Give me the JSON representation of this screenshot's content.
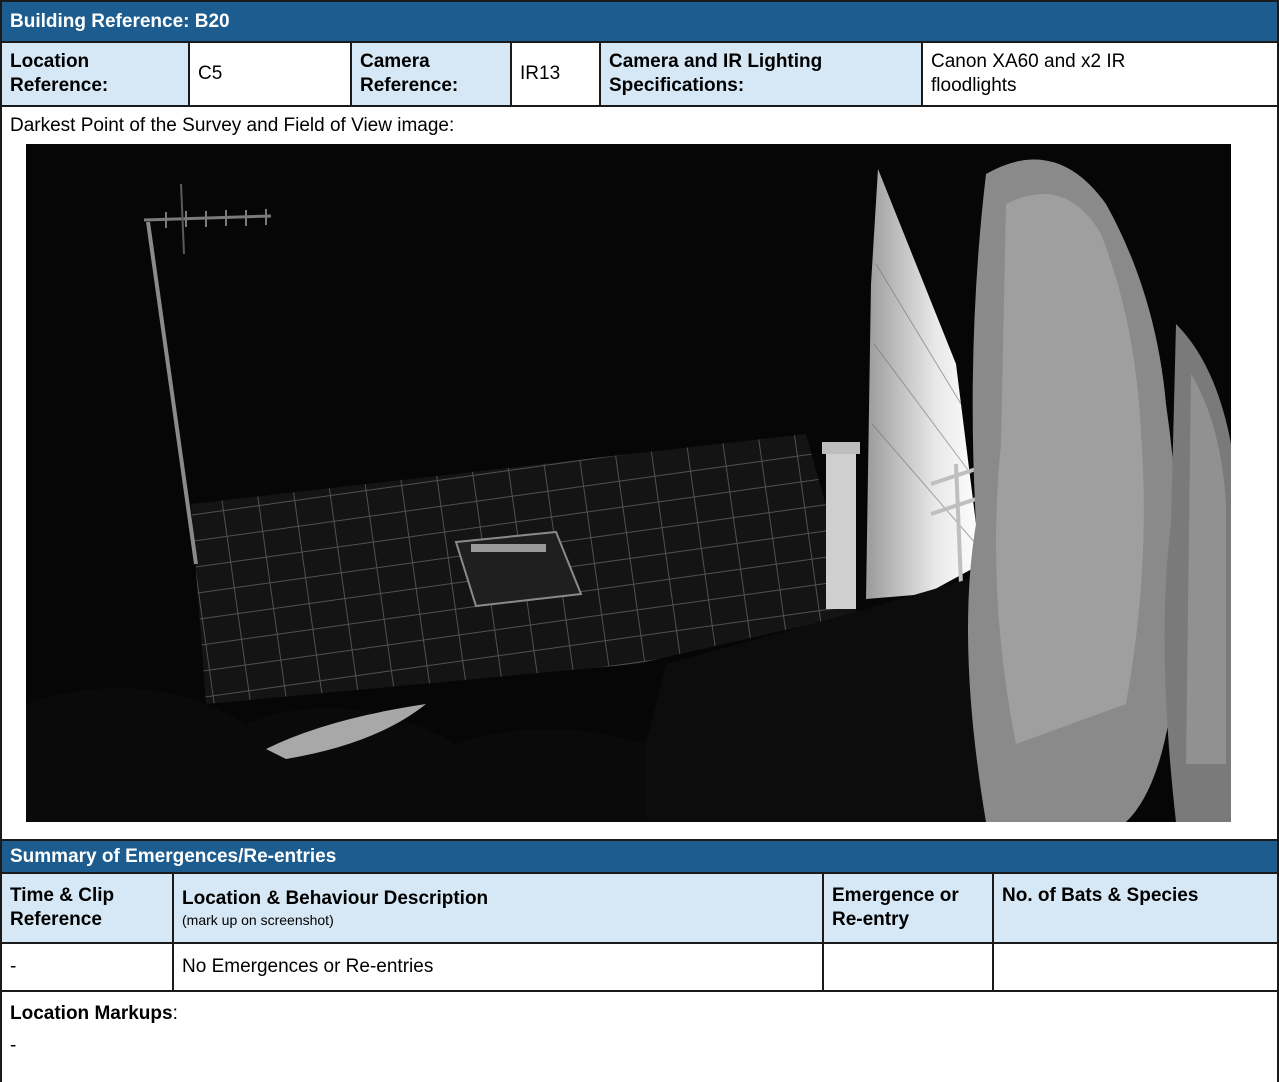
{
  "header": {
    "building_reference": "Building Reference: B20"
  },
  "info": {
    "location_label": "Location Reference:",
    "location_value": "C5",
    "camera_label": "Camera Reference:",
    "camera_value": "IR13",
    "spec_label": "Camera and IR Lighting Specifications:",
    "spec_value": "Canon XA60 and x2 IR floodlights"
  },
  "image_section": {
    "caption": "Darkest Point of the Survey and Field of View image:"
  },
  "summary": {
    "title": "Summary of Emergences/Re-entries",
    "columns": [
      {
        "label": "Time & Clip Reference",
        "sub": ""
      },
      {
        "label": "Location & Behaviour Description",
        "sub": "(mark up on screenshot)"
      },
      {
        "label": "Emergence or Re-entry",
        "sub": ""
      },
      {
        "label": "No. of Bats & Species",
        "sub": ""
      }
    ],
    "rows": [
      {
        "time": "-",
        "description": "No Emergences or Re-entries",
        "type": "",
        "bats": ""
      }
    ]
  },
  "markups": {
    "label": "Location Markups",
    "value": "-"
  }
}
